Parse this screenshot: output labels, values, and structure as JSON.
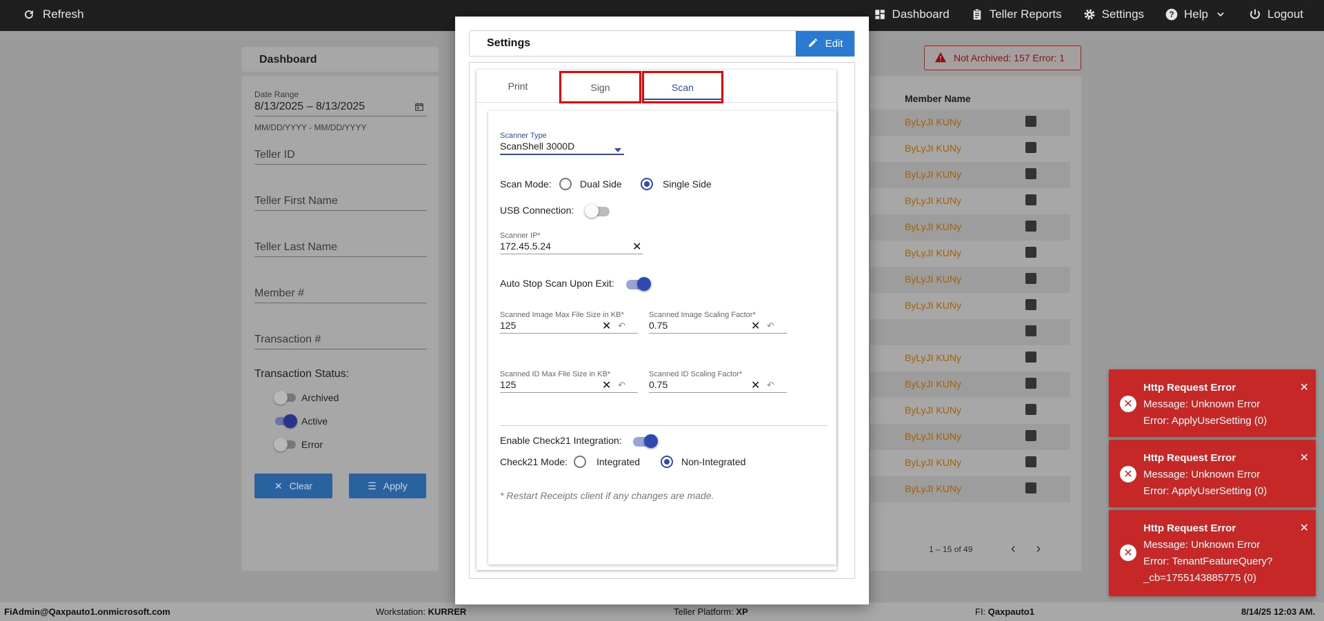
{
  "topbar": {
    "refresh_label": "Refresh",
    "nav": [
      {
        "label": "Dashboard",
        "icon": "dashboard-icon"
      },
      {
        "label": "Teller Reports",
        "icon": "clipboard-icon"
      },
      {
        "label": "Settings",
        "icon": "gear-icon"
      },
      {
        "label": "Help",
        "icon": "help-icon"
      },
      {
        "label": "Logout",
        "icon": "power-icon"
      }
    ]
  },
  "dashboard": {
    "title": "Dashboard",
    "filters": {
      "date_range_label": "Date Range",
      "date_range_value": "8/13/2025 – 8/13/2025",
      "date_range_hint": "MM/DD/YYYY - MM/DD/YYYY",
      "teller_id": "Teller ID",
      "teller_first_name": "Teller First Name",
      "teller_last_name": "Teller Last Name",
      "member_number": "Member #",
      "transaction_number": "Transaction #",
      "transaction_status_label": "Transaction Status:",
      "status_archived": "Archived",
      "status_active": "Active",
      "status_error": "Error",
      "clear_label": "Clear",
      "apply_label": "Apply"
    },
    "badge": "Not Archived: 157  Error: 1",
    "table": {
      "column": "Member Name",
      "rows": [
        "ByLyJI KUNy",
        "ByLyJI KUNy",
        "ByLyJI KUNy",
        "ByLyJI KUNy",
        "ByLyJI KUNy",
        "ByLyJI KUNy",
        "ByLyJI KUNy",
        "ByLyJI KUNy",
        "",
        "ByLyJI KUNy",
        "ByLyJI KUNy",
        "ByLyJI KUNy",
        "ByLyJI KUNy",
        "ByLyJI KUNy",
        "ByLyJI KUNy"
      ]
    },
    "pager": "1 – 15 of 49"
  },
  "status_bar": {
    "user": "FiAdmin@Qaxpauto1.onmicrosoft.com",
    "workstation_label": "Workstation:",
    "workstation": "KURRER",
    "platform_label": "Teller Platform:",
    "platform": "XP",
    "fi_label": "FI:",
    "fi": "Qaxpauto1",
    "datetime": "8/14/25 12:03 AM."
  },
  "modal": {
    "title": "Settings",
    "edit_label": "Edit",
    "tabs": [
      "Print",
      "Sign",
      "Scan"
    ],
    "scan": {
      "scanner_type_label": "Scanner Type",
      "scanner_type_value": "ScanShell 3000D",
      "scan_mode_label": "Scan Mode:",
      "dual_side": "Dual Side",
      "single_side": "Single Side",
      "usb_label": "USB Connection:",
      "scanner_ip_label": "Scanner IP*",
      "scanner_ip_value": "172.45.5.24",
      "auto_stop_label": "Auto Stop Scan Upon Exit:",
      "img_max_label": "Scanned Image Max File Size in KB*",
      "img_max_value": "125",
      "img_scale_label": "Scanned Image Scaling Factor*",
      "img_scale_value": "0.75",
      "id_max_label": "Scanned ID Max File Size in KB*",
      "id_max_value": "125",
      "id_scale_label": "Scanned ID Scaling Factor*",
      "id_scale_value": "0.75",
      "check21_label": "Enable Check21 Integration:",
      "check21_mode_label": "Check21 Mode:",
      "integrated": "Integrated",
      "non_integrated": "Non-Integrated",
      "note": "* Restart Receipts client if any changes are made."
    }
  },
  "toasts": [
    {
      "title": "Http Request Error",
      "message": "Message: Unknown Error",
      "error": "Error: ApplyUserSetting (0)",
      "extra": ""
    },
    {
      "title": "Http Request Error",
      "message": "Message: Unknown Error",
      "error": "Error: ApplyUserSetting (0)",
      "extra": ""
    },
    {
      "title": "Http Request Error",
      "message": "Message: Unknown Error",
      "error": "Error: TenantFeatureQuery?",
      "extra": "_cb=1755143885775 (0)"
    }
  ],
  "colors": {
    "accent": "#2f4ab1",
    "error": "#c62828",
    "edit_button": "#2a7ad1"
  }
}
